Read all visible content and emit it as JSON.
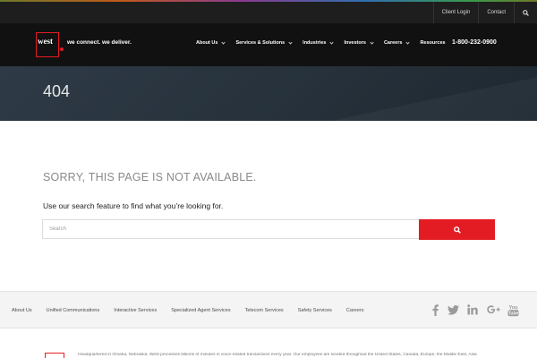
{
  "utility": {
    "links": [
      "Client Login",
      "Contact"
    ]
  },
  "header": {
    "logo_text": "west",
    "tagline": "we connect. we deliver.",
    "nav": [
      {
        "label": "About Us",
        "dropdown": true
      },
      {
        "label": "Services & Solutions",
        "dropdown": true
      },
      {
        "label": "Industries",
        "dropdown": true
      },
      {
        "label": "Investors",
        "dropdown": true
      },
      {
        "label": "Careers",
        "dropdown": true
      },
      {
        "label": "Resources",
        "dropdown": false
      }
    ],
    "phone": "1-800-232-0900"
  },
  "hero": {
    "title": "404"
  },
  "content": {
    "title": "SORRY, THIS PAGE IS NOT AVAILABLE.",
    "subtitle": "Use our search feature to find what you’re looking for.",
    "search_placeholder": "Search"
  },
  "footer": {
    "links": [
      "About Us",
      "Unified Communications",
      "Interactive Services",
      "Specialized Agent Services",
      "Telecom Services",
      "Safety Services",
      "Careers"
    ],
    "social_icons": [
      "facebook-icon",
      "twitter-icon",
      "linkedin-icon",
      "google-plus-icon",
      "youtube-icon"
    ]
  },
  "bottom": {
    "text": "Headquartered in Omaha, Nebraska, West processes billions of minutes in voice-related transactions every year.  Our employees are located throughout the United States, Canada, Europe, the Middle East, Asia"
  },
  "colors": {
    "brand_red": "#e31c23",
    "header_bg": "#111111",
    "hero_bg": "#2b3640"
  }
}
